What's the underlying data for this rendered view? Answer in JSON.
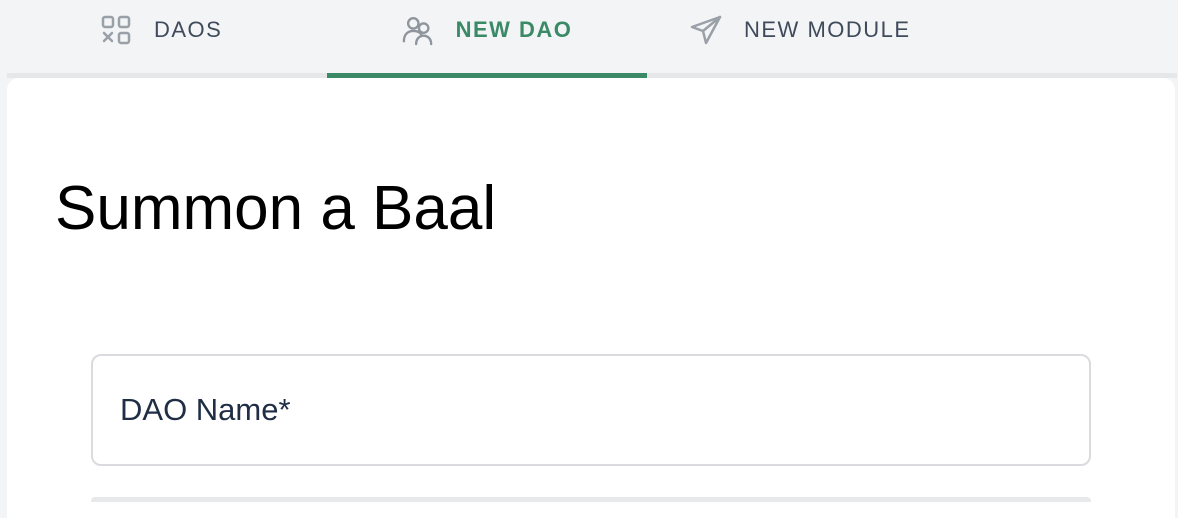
{
  "tabs": [
    {
      "label": "DAOS",
      "icon": "grid-icon",
      "active": false
    },
    {
      "label": "NEW DAO",
      "icon": "users-icon",
      "active": true
    },
    {
      "label": "NEW MODULE",
      "icon": "paper-plane-icon",
      "active": false
    }
  ],
  "main": {
    "title": "Summon a Baal",
    "dao_name_field": {
      "label": "DAO Name*",
      "value": ""
    }
  },
  "colors": {
    "accent": "#3a8a67",
    "tab_text": "#3f4a5a",
    "background": "#f3f4f6",
    "card": "#ffffff"
  }
}
